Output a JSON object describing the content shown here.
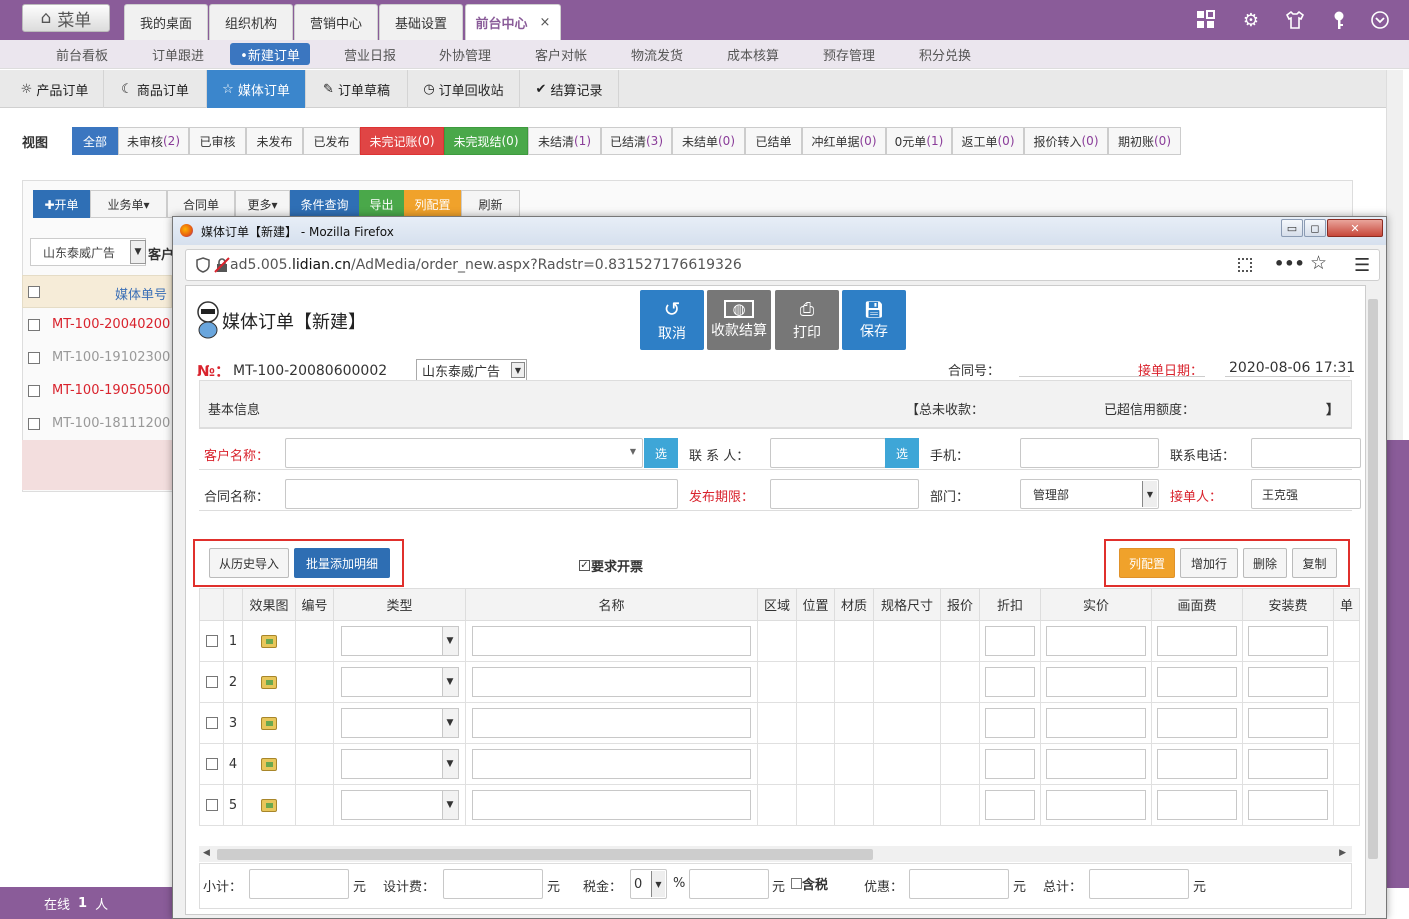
{
  "topbar": {
    "menu_label": "菜单",
    "tabs": [
      "我的桌面",
      "组织机构",
      "营销中心",
      "基础设置",
      "前台中心"
    ],
    "close_glyph": "×",
    "icons": [
      "grid-icon",
      "gear-icon",
      "shirt-icon",
      "key-icon",
      "chevron-down-icon"
    ]
  },
  "nav2": {
    "items": [
      "前台看板",
      "订单跟进",
      "•新建订单",
      "营业日报",
      "外协管理",
      "客户对帐",
      "物流发货",
      "成本核算",
      "预存管理",
      "积分兑换"
    ]
  },
  "tabs3": {
    "items": [
      "产品订单",
      "商品订单",
      "媒体订单",
      "订单草稿",
      "订单回收站",
      "结算记录"
    ]
  },
  "filter": {
    "label": "视图",
    "buttons": [
      {
        "text": "全部",
        "count": ""
      },
      {
        "text": "未审核",
        "count": "(2)"
      },
      {
        "text": "已审核",
        "count": ""
      },
      {
        "text": "未发布",
        "count": ""
      },
      {
        "text": "已发布",
        "count": ""
      },
      {
        "text": "未完记账",
        "count": "(0)"
      },
      {
        "text": "未完现结",
        "count": "(0)"
      },
      {
        "text": "未结清",
        "count": "(1)"
      },
      {
        "text": "已结清",
        "count": "(3)"
      },
      {
        "text": "未结单",
        "count": "(0)"
      },
      {
        "text": "已结单",
        "count": ""
      },
      {
        "text": "冲红单据",
        "count": "(0)"
      },
      {
        "text": "0元单",
        "count": "(1)"
      },
      {
        "text": "返工单",
        "count": "(0)"
      },
      {
        "text": "报价转入",
        "count": "(0)"
      },
      {
        "text": "期初账",
        "count": "(0)"
      }
    ]
  },
  "actions": {
    "buttons": [
      "✚开单",
      "业务单▾",
      "合同单",
      "更多▾",
      "条件查询",
      "导出",
      "列配置",
      "刷新"
    ]
  },
  "background_list": {
    "company_select": "山东泰威广告",
    "customer_label": "客户",
    "column_header": "媒体单号",
    "rows": [
      "MT-100-20040200",
      "MT-100-19102300",
      "MT-100-19050500",
      "MT-100-18111200"
    ]
  },
  "status": {
    "online_label": "在线",
    "online_count": "1",
    "unit": "人"
  },
  "popup": {
    "window_title": "媒体订单【新建】 - Mozilla Firefox",
    "url_prefix": "ad5.005.",
    "url_domain": "lidian.cn",
    "url_path": "/AdMedia/order_new.aspx?Radstr=0.831527176619326",
    "page_title": "媒体订单【新建】",
    "buttons": {
      "cancel": "取消",
      "settle": "收款结算",
      "print": "打印",
      "save": "保存"
    },
    "order_no_label": "№：",
    "order_no": "MT-100-20080600002",
    "company": "山东泰威广告",
    "contract_no_label": "合同号：",
    "date_label": "接单日期：",
    "date_value": "2020-08-06 17:31",
    "basic_info": "基本信息",
    "total_uncollected": "【总未收款：",
    "credit_exceeded": "已超信用额度：",
    "bracket_close": "】",
    "fields": {
      "customer_name": "客户名称：",
      "contact": "联 系 人：",
      "mobile": "手机：",
      "phone": "联系电话：",
      "contract_name": "合同名称：",
      "publish_deadline": "发布期限：",
      "department": "部门：",
      "department_value": "管理部",
      "receiver": "接单人：",
      "receiver_value": "王克强",
      "select_btn": "选"
    },
    "import_history": "从历史导入",
    "batch_add": "批量添加明细",
    "invoice_label": "要求开票",
    "col_config": "列配置",
    "add_row": "增加行",
    "delete": "删除",
    "copy": "复制",
    "table": {
      "headers": [
        "效果图",
        "编号",
        "类型",
        "名称",
        "区域",
        "位置",
        "材质",
        "规格尺寸",
        "报价",
        "折扣",
        "实价",
        "画面费",
        "安装费",
        "单"
      ],
      "rows": [
        "1",
        "2",
        "3",
        "4",
        "5"
      ]
    },
    "footer": {
      "subtotal": "小计：",
      "yuan": "元",
      "design_fee": "设计费：",
      "tax_rate": "税金：",
      "tax_value": "0",
      "percent": "%",
      "tax_included": "含税",
      "discount": "优惠：",
      "total": "总计："
    }
  },
  "colors": {
    "purple": "#8a5c99",
    "blue": "#3b86cc",
    "red": "#d9232d",
    "orange": "#f0a22b",
    "green": "#4aa84a"
  }
}
